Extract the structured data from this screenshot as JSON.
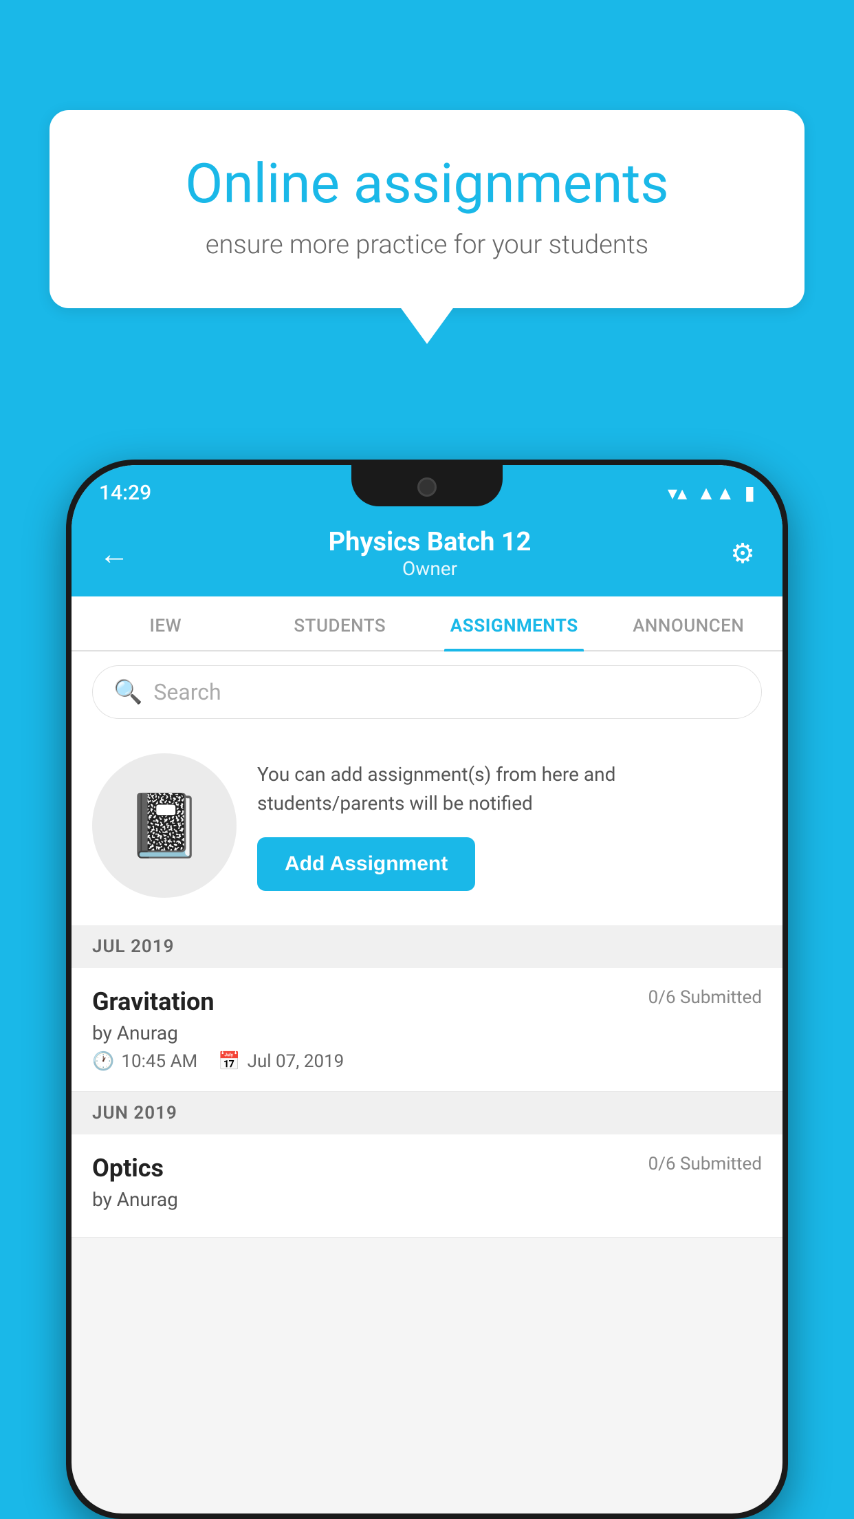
{
  "background_color": "#1ab8e8",
  "speech_bubble": {
    "title": "Online assignments",
    "subtitle": "ensure more practice for your students"
  },
  "status_bar": {
    "time": "14:29",
    "wifi": "▼",
    "signal": "▲",
    "battery": "■"
  },
  "header": {
    "title": "Physics Batch 12",
    "subtitle": "Owner",
    "back_label": "←",
    "settings_label": "⚙"
  },
  "tabs": [
    {
      "label": "IEW",
      "active": false
    },
    {
      "label": "STUDENTS",
      "active": false
    },
    {
      "label": "ASSIGNMENTS",
      "active": true
    },
    {
      "label": "ANNOUNCEN",
      "active": false
    }
  ],
  "search": {
    "placeholder": "Search"
  },
  "info_card": {
    "description": "You can add assignment(s) from here and students/parents will be notified",
    "button_label": "Add Assignment"
  },
  "sections": [
    {
      "header": "JUL 2019",
      "items": [
        {
          "title": "Gravitation",
          "submitted": "0/6 Submitted",
          "author": "by Anurag",
          "time": "10:45 AM",
          "date": "Jul 07, 2019"
        }
      ]
    },
    {
      "header": "JUN 2019",
      "items": [
        {
          "title": "Optics",
          "submitted": "0/6 Submitted",
          "author": "by Anurag",
          "time": "",
          "date": ""
        }
      ]
    }
  ]
}
